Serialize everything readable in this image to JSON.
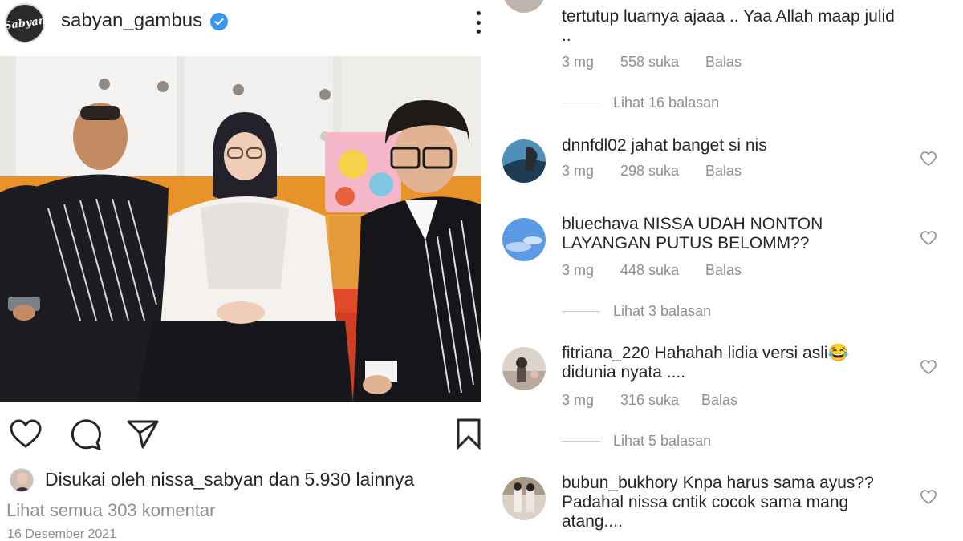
{
  "post": {
    "username": "sabyan_gambus",
    "avatar_text": "Sabyan",
    "likes_prefix": "Disukai oleh ",
    "likes_user": "nissa_sabyan",
    "likes_middle": " dan ",
    "likes_count": "5.930 lainnya",
    "view_all_comments": "Lihat semua 303 komentar",
    "date": "16 Desember 2021"
  },
  "comments": [
    {
      "username": "",
      "text": "tertutup luarnya ajaaa .. Yaa Allah maap julid ..",
      "time": "3 mg",
      "likes": "558 suka",
      "reply": "Balas",
      "replies_label": "Lihat 16 balasan"
    },
    {
      "username": "dnnfdl02",
      "text": "jahat banget si nis",
      "time": "3 mg",
      "likes": "298 suka",
      "reply": "Balas"
    },
    {
      "username": "bluechava",
      "text": "NISSA UDAH NONTON LAYANGAN PUTUS BELOMM??",
      "time": "3 mg",
      "likes": "448 suka",
      "reply": "Balas",
      "replies_label": "Lihat 3 balasan"
    },
    {
      "username": "fitriana_220",
      "text": "Hahahah lidia versi asli😂 didunia nyata ....",
      "time": "3 mg",
      "likes": "316 suka",
      "reply": "Balas",
      "replies_label": "Lihat 5 balasan"
    },
    {
      "username": "bubun_bukhory",
      "text": "Knpa harus sama ayus?? Padahal nissa cntik cocok sama mang atang....",
      "time": "",
      "likes": "",
      "reply": ""
    }
  ],
  "icons": {
    "like": "heart-icon",
    "comment": "comment-bubble-icon",
    "share": "paper-plane-icon",
    "save": "bookmark-icon",
    "more": "more-vertical-icon",
    "verified": "verified-badge-icon",
    "comment_like": "heart-outline-icon"
  },
  "colors": {
    "text": "#262626",
    "secondary": "#8e8e8e",
    "verified": "#3897f0"
  }
}
